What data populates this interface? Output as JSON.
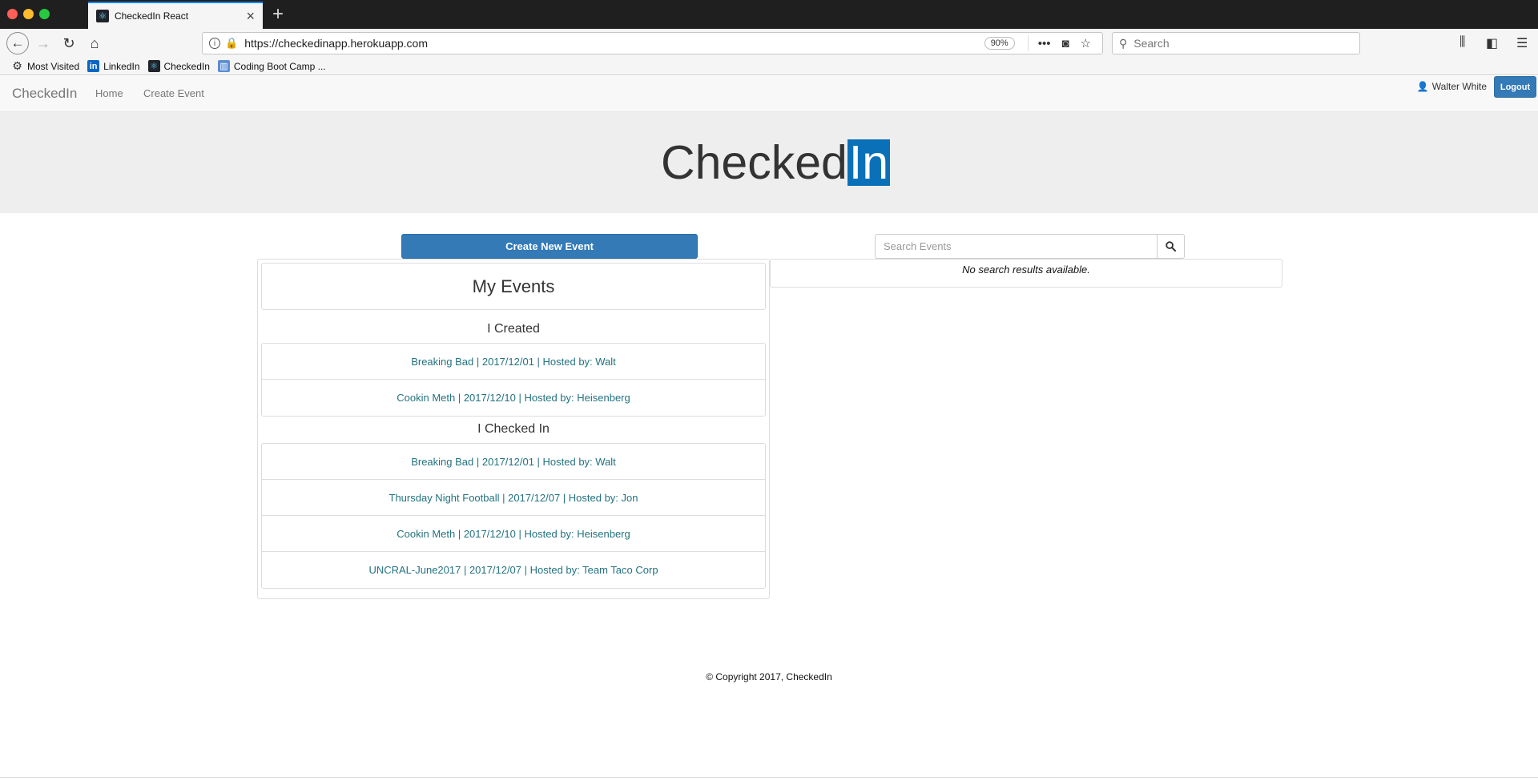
{
  "browser": {
    "tab_title": "CheckedIn React",
    "url": "https://checkedinapp.herokuapp.com",
    "zoom": "90%",
    "search_placeholder": "Search",
    "bookmarks": [
      "Most Visited",
      "LinkedIn",
      "CheckedIn",
      "Coding Boot Camp ..."
    ]
  },
  "nav": {
    "brand": "CheckedIn",
    "links": [
      "Home",
      "Create Event"
    ],
    "user": "Walter White",
    "logout": "Logout"
  },
  "hero": {
    "logo_main": "Checked",
    "logo_highlight": "In"
  },
  "actions": {
    "create_button": "Create New Event"
  },
  "search": {
    "placeholder": "Search Events",
    "no_results": "No search results available."
  },
  "my_events": {
    "title": "My Events",
    "created_title": "I Created",
    "created": [
      "Breaking Bad | 2017/12/01 | Hosted by: Walt",
      "Cookin Meth | 2017/12/10 | Hosted by: Heisenberg"
    ],
    "checked_in_title": "I Checked In",
    "checked_in": [
      "Breaking Bad | 2017/12/01 | Hosted by: Walt",
      "Thursday Night Football | 2017/12/07 | Hosted by: Jon",
      "Cookin Meth | 2017/12/10 | Hosted by: Heisenberg",
      "UNCRAL-June2017 | 2017/12/07 | Hosted by: Team Taco Corp"
    ]
  },
  "footer": {
    "text": "© Copyright 2017, CheckedIn"
  },
  "colors": {
    "primary": "#337ab7",
    "link": "#23727f",
    "logo_highlight": "#0a71b8"
  }
}
